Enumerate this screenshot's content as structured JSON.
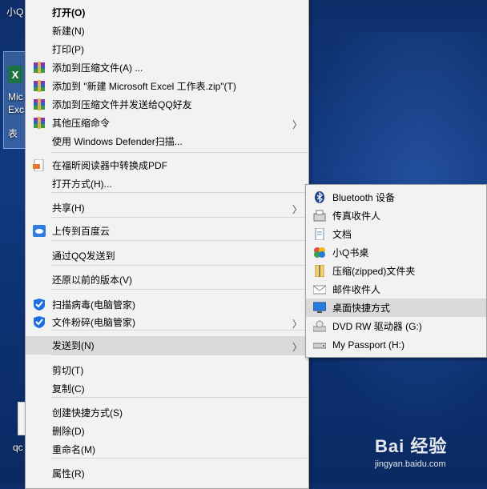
{
  "desktop": {
    "top_label": "小Q",
    "file_label_lines": [
      "Mic",
      "Exc",
      "表"
    ],
    "bottom_label": "qc",
    "excel_glyph": "X"
  },
  "context_menu": {
    "items": [
      {
        "label": "打开(O)",
        "bold": true,
        "icon": ""
      },
      {
        "label": "新建(N)",
        "icon": ""
      },
      {
        "label": "打印(P)",
        "icon": ""
      },
      {
        "label": "添加到压缩文件(A) ...",
        "icon": "winrar-icon"
      },
      {
        "label": "添加到 \"新建 Microsoft Excel 工作表.zip\"(T)",
        "icon": "winrar-icon"
      },
      {
        "label": "添加到压缩文件并发送给QQ好友",
        "icon": "winrar-icon"
      },
      {
        "label": "其他压缩命令",
        "icon": "winrar-icon",
        "submenu": true
      },
      {
        "label": "使用 Windows Defender扫描...",
        "icon": ""
      },
      {
        "label": "在福昕阅读器中转换成PDF",
        "icon": "pdf-icon"
      },
      {
        "label": "打开方式(H)...",
        "icon": ""
      },
      {
        "label": "共享(H)",
        "icon": "",
        "submenu": true
      },
      {
        "label": "上传到百度云",
        "icon": "baidu-cloud-icon"
      },
      {
        "label": "通过QQ发送到",
        "icon": ""
      },
      {
        "label": "还原以前的版本(V)",
        "icon": ""
      },
      {
        "label": "扫描病毒(电脑管家)",
        "icon": "shield-icon"
      },
      {
        "label": "文件粉碎(电脑管家)",
        "icon": "shield-icon",
        "submenu": true
      },
      {
        "label": "发送到(N)",
        "icon": "",
        "submenu": true,
        "highlighted": true
      },
      {
        "label": "剪切(T)",
        "icon": ""
      },
      {
        "label": "复制(C)",
        "icon": ""
      },
      {
        "label": "创建快捷方式(S)",
        "icon": ""
      },
      {
        "label": "删除(D)",
        "icon": ""
      },
      {
        "label": "重命名(M)",
        "icon": ""
      },
      {
        "label": "属性(R)",
        "icon": ""
      }
    ]
  },
  "send_to_menu": {
    "items": [
      {
        "label": "Bluetooth 设备",
        "icon": "bluetooth-icon"
      },
      {
        "label": "传真收件人",
        "icon": "fax-icon"
      },
      {
        "label": "文档",
        "icon": "document-icon"
      },
      {
        "label": "小Q书桌",
        "icon": "flower-icon"
      },
      {
        "label": "压缩(zipped)文件夹",
        "icon": "zip-folder-icon"
      },
      {
        "label": "邮件收件人",
        "icon": "mail-icon"
      },
      {
        "label": "桌面快捷方式",
        "icon": "desktop-icon",
        "highlighted": true
      },
      {
        "label": "DVD RW 驱动器 (G:)",
        "icon": "dvd-drive-icon"
      },
      {
        "label": "My Passport (H:)",
        "icon": "usb-drive-icon"
      }
    ]
  },
  "submenu_arrow": "〉",
  "watermark": {
    "logo": "Bai 经验",
    "url": "jingyan.baidu.com"
  },
  "colors": {
    "menu_bg": "#f2f2f2",
    "highlight": "#dadada",
    "desktop": "#123a82"
  }
}
